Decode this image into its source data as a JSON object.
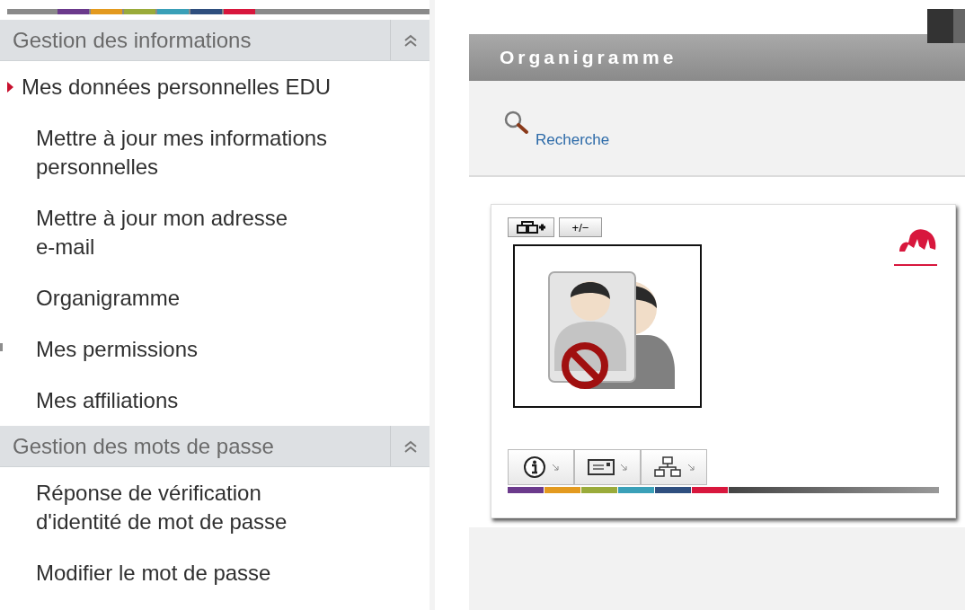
{
  "sidebar": {
    "sections": [
      {
        "title": "Gestion des informations",
        "expanded": true,
        "items": [
          {
            "label": "Mes données personnelles EDU",
            "selected": true
          },
          {
            "label": "Mettre à jour mes informations\npersonnelles",
            "selected": false
          },
          {
            "label": "Mettre à jour mon adresse\ne-mail",
            "selected": false
          },
          {
            "label": "Organigramme",
            "selected": false
          },
          {
            "label": "Mes permissions",
            "selected": false
          },
          {
            "label": "Mes affiliations",
            "selected": false
          }
        ]
      },
      {
        "title": "Gestion des mots de passe",
        "expanded": true,
        "items": [
          {
            "label": "Réponse de vérification\nd'identité de mot de passe",
            "selected": false
          },
          {
            "label": "Modifier le mot de passe",
            "selected": false
          }
        ]
      }
    ]
  },
  "panel": {
    "title": "Organigramme",
    "search_link": "Recherche",
    "card": {
      "toolbar": [
        {
          "kind": "add-node"
        },
        {
          "kind": "toggle",
          "label": "+/−"
        }
      ],
      "tabs": [
        {
          "kind": "info"
        },
        {
          "kind": "card"
        },
        {
          "kind": "tree"
        }
      ]
    }
  }
}
